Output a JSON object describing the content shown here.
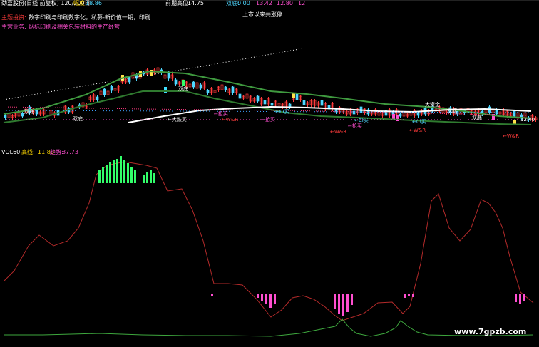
{
  "header": {
    "stock_title": "劲嘉股份(日线 前复权) 120/200日",
    "amplitude_label": "幅度",
    "amplitude_value": "18.86",
    "prev_high_label": "前期高位:",
    "prev_high_value": "14.75",
    "double_bottom_label": "双底:",
    "double_bottom_value": "0.00",
    "value_a": "13.42",
    "value_b": "12.80",
    "value_c": "12"
  },
  "info": {
    "topic_label": "主题投资:",
    "topic_text": "数字印刷与印刷数字化，私募-新价值一期，印刷",
    "business_label": "主营业务:",
    "business_text": "烟标印刷及相关包装材料的生产经营",
    "listing_note": "上市以来共涨停"
  },
  "price_annotations": {
    "double_bottom_1": "双底",
    "double_bottom_2": "双底",
    "double_bottom_3": "双底",
    "double_bottom_4": "双底",
    "double_bottom_5": "双底",
    "big_fall_buy": "←大跌买",
    "limit_buy_1": "←抢买",
    "limit_buy_2": "←抢买",
    "limit_buy_3": "←抢买",
    "wr_1": "←W&R",
    "wr_2": "←W&R",
    "wr_3": "←W&R",
    "wr_4": "←W&R",
    "ci_buy_1": "←CI买",
    "ci_buy_2": "←CI买",
    "ci_buy_3": "←CI买",
    "big_money": "大资金",
    "price_right": "12.40"
  },
  "indicator": {
    "name": "VOL60",
    "high_label": "高线:",
    "high_value": "11.89",
    "low_label": "趋势:",
    "low_value": "37.73"
  },
  "watermark": "www.7gpzb.com",
  "colors": {
    "background": "#000000",
    "up": "#ff3b3b",
    "down": "#4fd7ff",
    "ma_white": "#ffffff",
    "ma_green": "#3f9a3f",
    "indicator_line": "#b32a2a",
    "bar_green": "#32ff6a",
    "bar_magenta": "#ff4fd0"
  }
}
